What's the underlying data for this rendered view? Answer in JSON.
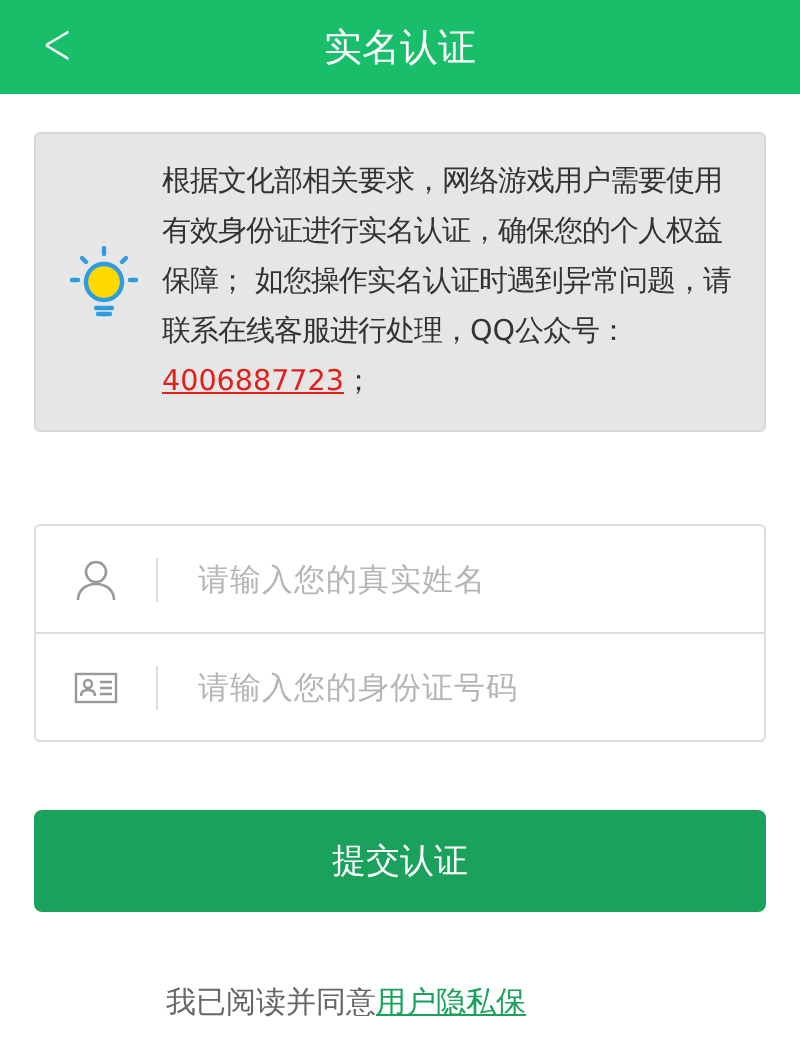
{
  "header": {
    "back": "<",
    "title": "实名认证"
  },
  "notice": {
    "text": "根据文化部相关要求，网络游戏用户需要使用有效身份证进行实名认证，确保您的个人权益保障； 如您操作实名认证时遇到异常问题，请联系在线客服进行处理，QQ公众号：",
    "phone": "4006887723",
    "tail": "；"
  },
  "fields": [
    {
      "kind": "person",
      "placeholder": "请输入您的真实姓名"
    },
    {
      "kind": "idcard",
      "placeholder": "请输入您的身份证号码"
    }
  ],
  "submit": "提交认证",
  "agreement": {
    "text": "我已阅读并同意",
    "link": "用户隐私保"
  }
}
